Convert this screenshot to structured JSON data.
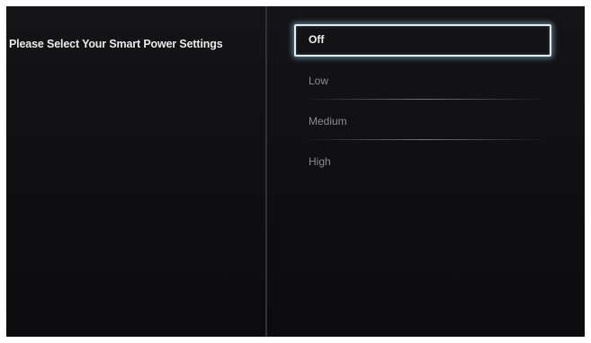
{
  "prompt": "Please Select Your Smart Power Settings",
  "options": [
    {
      "label": "Off",
      "selected": true
    },
    {
      "label": "Low",
      "selected": false
    },
    {
      "label": "Medium",
      "selected": false
    },
    {
      "label": "High",
      "selected": false
    }
  ],
  "colors": {
    "background": "#0f0f11",
    "text_primary": "#e9e9ea",
    "text_muted": "#8c8c8f",
    "highlight_border": "#e6eef2",
    "highlight_glow": "#96cdeb"
  }
}
